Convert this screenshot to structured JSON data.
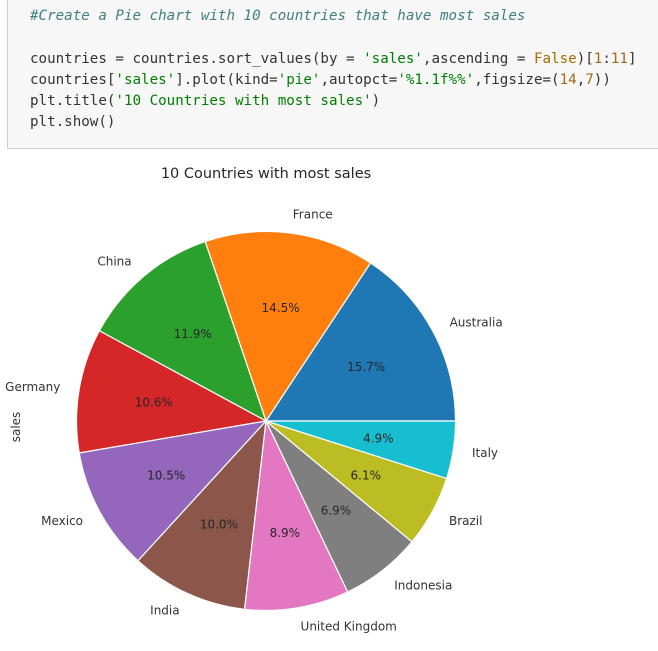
{
  "code_cell": {
    "lines": [
      [
        {
          "t": "#Create a Pie chart with 10 countries that have most sales",
          "c": "cm"
        }
      ],
      [],
      [
        {
          "t": "countries = countries.sort_values(by = ",
          "c": ""
        },
        {
          "t": "'sales'",
          "c": "str"
        },
        {
          "t": ",ascending = ",
          "c": ""
        },
        {
          "t": "False",
          "c": "kw"
        },
        {
          "t": ")[",
          "c": ""
        },
        {
          "t": "1",
          "c": "num"
        },
        {
          "t": ":",
          "c": ""
        },
        {
          "t": "11",
          "c": "num"
        },
        {
          "t": "]",
          "c": ""
        }
      ],
      [
        {
          "t": "countries[",
          "c": ""
        },
        {
          "t": "'sales'",
          "c": "str"
        },
        {
          "t": "].plot(kind=",
          "c": ""
        },
        {
          "t": "'pie'",
          "c": "str"
        },
        {
          "t": ",autopct=",
          "c": ""
        },
        {
          "t": "'%1.1f%%'",
          "c": "str"
        },
        {
          "t": ",figsize=(",
          "c": ""
        },
        {
          "t": "14",
          "c": "num"
        },
        {
          "t": ",",
          "c": ""
        },
        {
          "t": "7",
          "c": "num"
        },
        {
          "t": "))",
          "c": ""
        }
      ],
      [
        {
          "t": "plt.title(",
          "c": ""
        },
        {
          "t": "'10 Countries with most sales'",
          "c": "str"
        },
        {
          "t": ")",
          "c": ""
        }
      ],
      [
        {
          "t": "plt.show()",
          "c": ""
        }
      ]
    ]
  },
  "chart_data": {
    "type": "pie",
    "title": "10 Countries with most sales",
    "ylabel": "sales",
    "startangle_deg": 0,
    "direction": "counterclockwise",
    "autopct": "%1.1f%%",
    "categories": [
      "Australia",
      "France",
      "China",
      "Germany",
      "Mexico",
      "India",
      "United Kingdom",
      "Indonesia",
      "Brazil",
      "Italy"
    ],
    "values": [
      15.7,
      14.5,
      11.9,
      10.6,
      10.5,
      10.0,
      8.9,
      6.9,
      6.1,
      4.9
    ],
    "pct_labels": [
      "15.7%",
      "14.5%",
      "11.9%",
      "10.6%",
      "10.5%",
      "10.0%",
      "8.9%",
      "6.9%",
      "6.1%",
      "4.9%"
    ],
    "colors": [
      "#1f77b4",
      "#ff7f0e",
      "#2ca02c",
      "#d62728",
      "#9467bd",
      "#8c564b",
      "#e377c2",
      "#7f7f7f",
      "#bcbd22",
      "#17becf"
    ],
    "edge_color": "#ffffff",
    "label_color": "#333333",
    "pct_color": "#262626"
  }
}
